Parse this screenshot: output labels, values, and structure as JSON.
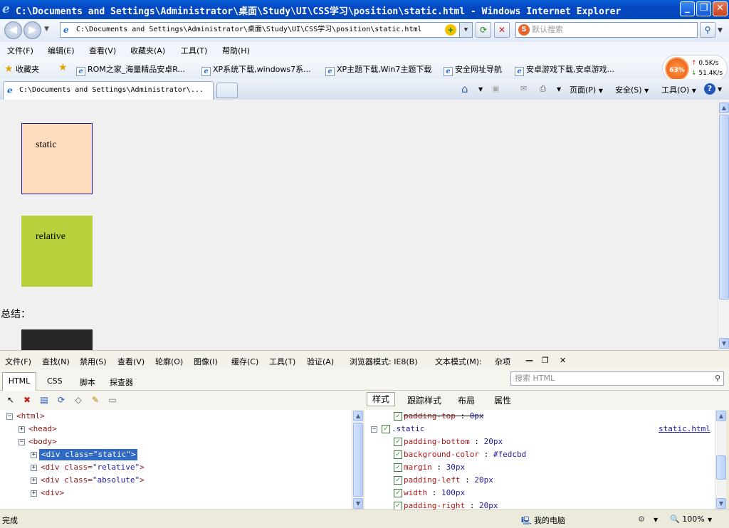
{
  "window": {
    "title": "C:\\Documents and Settings\\Administrator\\桌面\\Study\\UI\\CSS学习\\position\\static.html - Windows Internet Explorer"
  },
  "address": {
    "url": "C:\\Documents and Settings\\Administrator\\桌面\\Study\\UI\\CSS学习\\position\\static.html",
    "search_placeholder": "默认搜索"
  },
  "menu": [
    "文件(F)",
    "编辑(E)",
    "查看(V)",
    "收藏夹(A)",
    "工具(T)",
    "帮助(H)"
  ],
  "favorites": {
    "label": "收藏夹",
    "items": [
      "ROM之家_海量精品安卓R...",
      "XP系统下载,windows7系...",
      "XP主题下载,Win7主题下载",
      "安全网址导航",
      "安卓游戏下载,安卓游戏..."
    ]
  },
  "speed": {
    "percent": "63%",
    "up": "0.5K/s",
    "down": "51.4K/s"
  },
  "tab": {
    "title": "C:\\Documents and Settings\\Administrator\\..."
  },
  "commandbar": {
    "page": "页面(P)",
    "safety": "安全(S)",
    "tools": "工具(O)"
  },
  "page": {
    "static_label": "static",
    "relative_label": "relative",
    "summary": "总结："
  },
  "devtools": {
    "menu": [
      "文件(F)",
      "查找(N)",
      "禁用(S)",
      "查看(V)",
      "轮廓(O)",
      "图像(I)",
      "缓存(C)",
      "工具(T)",
      "验证(A)",
      "浏览器模式: IE8(B)",
      "文本模式(M):",
      "杂项"
    ],
    "tabs": [
      "HTML",
      "CSS",
      "脚本",
      "探查器"
    ],
    "search_placeholder": "搜索 HTML",
    "right_tabs": [
      "样式",
      "跟踪样式",
      "布局",
      "属性"
    ],
    "tree": {
      "html": "<html>",
      "head": "<head>",
      "body": "<body>",
      "div_static": {
        "open": "<div ",
        "attr": "class=",
        "val": "\"static\"",
        "close": ">"
      },
      "div_relative": {
        "open": "<div ",
        "attr": "class=",
        "val": "\"relative\"",
        "close": ">"
      },
      "div_absolute": {
        "open": "<div ",
        "attr": "class=",
        "val": "\"absolute\"",
        "close": ">"
      },
      "div": "<div>"
    },
    "styles": {
      "top_prop": {
        "name": "padding-top",
        "value": "0px"
      },
      "rule": ".static",
      "source": "static.html",
      "props": [
        {
          "name": "padding-bottom",
          "value": "20px"
        },
        {
          "name": "background-color",
          "value": "#fedcbd"
        },
        {
          "name": "margin",
          "value": "30px"
        },
        {
          "name": "padding-left",
          "value": "20px"
        },
        {
          "name": "width",
          "value": "100px"
        },
        {
          "name": "padding-right",
          "value": "20px"
        }
      ]
    }
  },
  "status": {
    "text": "完成",
    "zone": "我的电脑",
    "zoom": "100%"
  }
}
